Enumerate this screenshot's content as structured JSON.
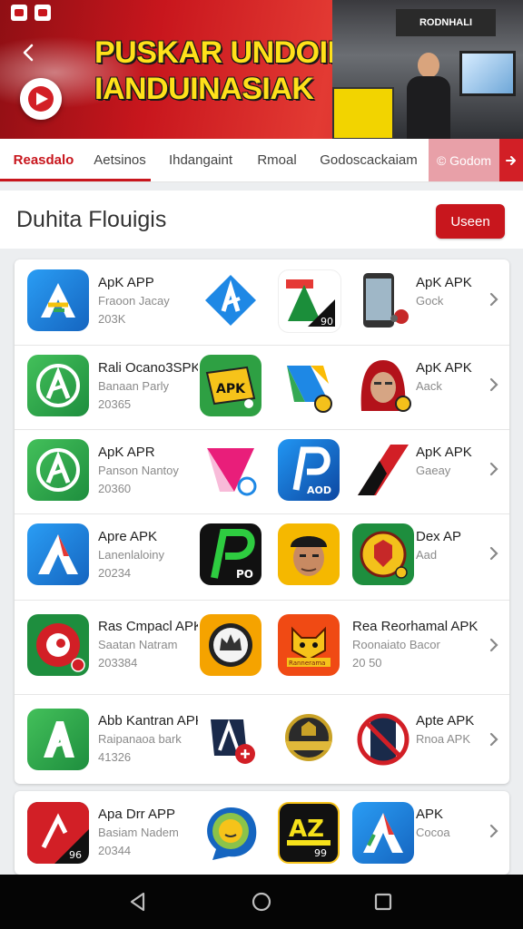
{
  "hero": {
    "title_line1": "PUSKAR UNDOIHAN",
    "title_line2": "IANDUINASIAK",
    "store_sign": "RODNHALI"
  },
  "tabs": [
    {
      "label": "Reasdalo"
    },
    {
      "label": "Aetsinos"
    },
    {
      "label": "Ihdangaint"
    },
    {
      "label": "Rmoal"
    },
    {
      "label": "Godoscackaiam"
    },
    {
      "label": "© Godom"
    }
  ],
  "section": {
    "title": "Duhita Flouigis",
    "button_label": "Useen"
  },
  "rows": [
    {
      "left": {
        "name": "ApK APP",
        "line2": "Fraoon Jacay",
        "line3": "203K"
      },
      "right": {
        "name": "ApK APK",
        "line2": "Gock",
        "line3": ""
      },
      "icons": [
        "apk-store-blue-icon",
        "android-a-icon",
        "apk-green-black-icon",
        "smartphone-icon"
      ]
    },
    {
      "left": {
        "name": "Rali Ocano3SPK",
        "line2": "Banaan Parly",
        "line3": "20365"
      },
      "right": {
        "name": "ApK APK",
        "line2": "Aack",
        "line3": ""
      },
      "icons": [
        "apk-green-circle-icon",
        "apk-yellow-tag-icon",
        "colorful-triangle-icon",
        "red-hood-avatar-icon"
      ]
    },
    {
      "left": {
        "name": "ApK APR",
        "line2": "Panson Nantoy",
        "line3": "20360"
      },
      "right": {
        "name": "ApK APK",
        "line2": "Gaeay",
        "line3": ""
      },
      "icons": [
        "apk-green-circle-icon",
        "pink-geometric-icon",
        "p-aod-icon",
        "red-black-a-icon"
      ]
    },
    {
      "left": {
        "name": "Apre APK",
        "line2": "Lanenlaloiny",
        "line3": "20234"
      },
      "right": {
        "name": "Dex AP",
        "line2": "Aad",
        "line3": ""
      },
      "icons": [
        "apk-blue-red-icon",
        "green-p-icon",
        "person-cap-icon",
        "shield-crest-icon"
      ]
    },
    {
      "left": {
        "name": "Ras Cmpacl APK",
        "line2": "Saatan Natram",
        "line3": "203384"
      },
      "right": {
        "name": "Rea Reorhamal APK",
        "line2": "Roonaiato Bacor",
        "line3": "20 50"
      },
      "icons": [
        "red-bird-icon",
        "crown-badge-icon",
        "orange-mask-icon",
        "apk-blue-red-icon"
      ]
    },
    {
      "left": {
        "name": "Abb Kantran APK",
        "line2": "Raipanaoa bark",
        "line3": "41326"
      },
      "right": {
        "name": "Apte APK",
        "line2": "Rnoa APK",
        "line3": ""
      },
      "icons": [
        "apk-green-a-icon",
        "dark-a-badge-icon",
        "gold-shield-icon",
        "no-entry-phone-icon"
      ]
    },
    {
      "left": {
        "name": "Apa Drr APP",
        "line2": "Basiam Nadem",
        "line3": "20344"
      },
      "right": {
        "name": "APK",
        "line2": "Cocoa",
        "line3": ""
      },
      "icons": [
        "red-black-a-icon",
        "green-bubble-face-icon",
        "yellow-az-icon",
        "apk-blue-red-icon"
      ]
    }
  ],
  "tile_labels": {
    "r1_t4_badge": "90",
    "r3_t3_text": "AOD",
    "r4_t2_text": "PO",
    "r5_t3_text": "Rannerama",
    "r7_t1_text": "96",
    "r7_t3_text": "AZ",
    "r7_t3_sub": "99",
    "r2_t2_text": "APK"
  },
  "colors": {
    "accent": "#c8161d",
    "title_yellow": "#ffe11a",
    "navbar": "#050505"
  }
}
